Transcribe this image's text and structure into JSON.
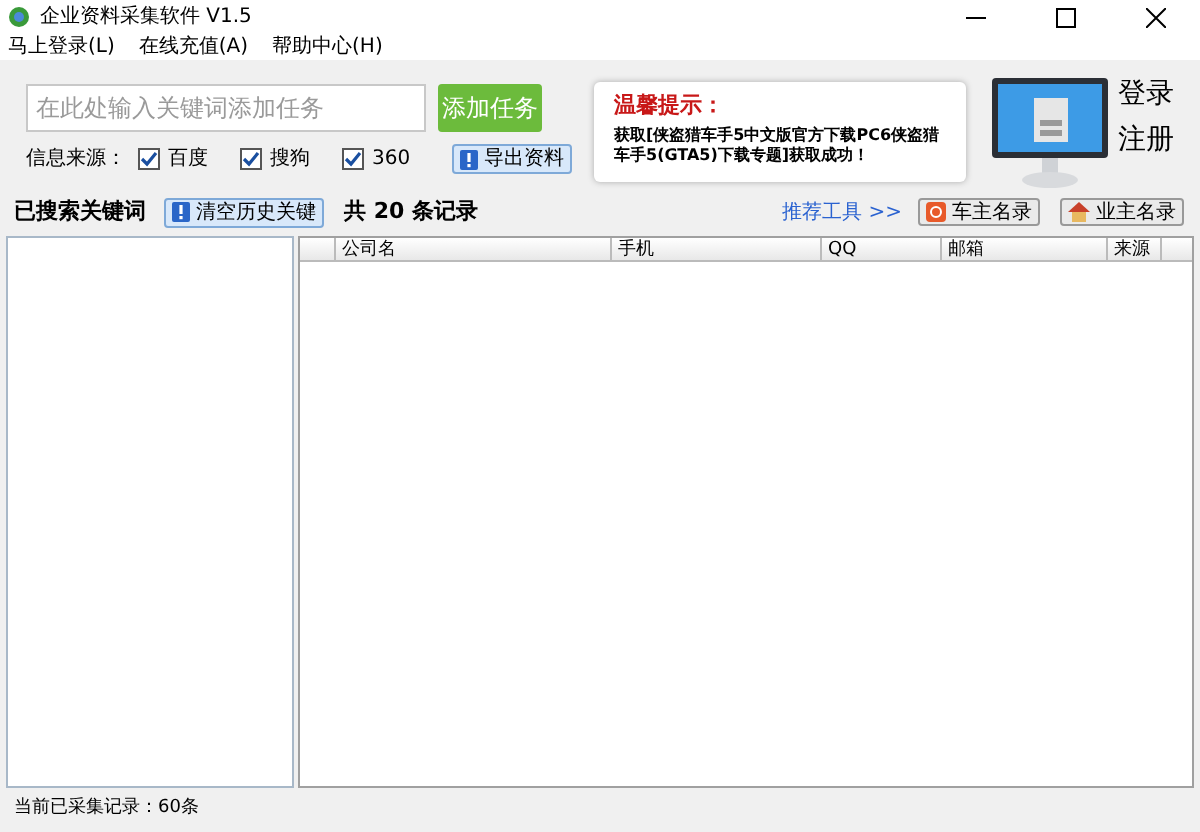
{
  "window": {
    "title": "企业资料采集软件 V1.5"
  },
  "menu": [
    "马上登录(L)",
    "在线充值(A)",
    "帮助中心(H)"
  ],
  "task_input": {
    "placeholder": "在此处输入关键词添加任务"
  },
  "add_button": "添加任务",
  "sources": {
    "label": "信息来源：",
    "items": [
      {
        "label": "百度",
        "checked": true
      },
      {
        "label": "搜狗",
        "checked": true
      },
      {
        "label": "360",
        "checked": true
      }
    ]
  },
  "export_button": "导出资料",
  "notice": {
    "title": "温馨提示：",
    "message": "获取[侠盗猎车手5中文版官方下载PC6侠盗猎车手5(GTA5)下载专题]获取成功！"
  },
  "account": [
    "登录",
    "注册"
  ],
  "keywords": {
    "title": "已搜索关键词",
    "clear_button": "清空历史关键"
  },
  "records": {
    "count": "共 20 条记录",
    "recommend": "推荐工具 >>",
    "tools": [
      "车主名录",
      "业主名录"
    ]
  },
  "table": {
    "columns": [
      "公司名",
      "手机",
      "QQ",
      "邮箱",
      "来源"
    ]
  },
  "status_bar": "当前已采集记录：60条"
}
